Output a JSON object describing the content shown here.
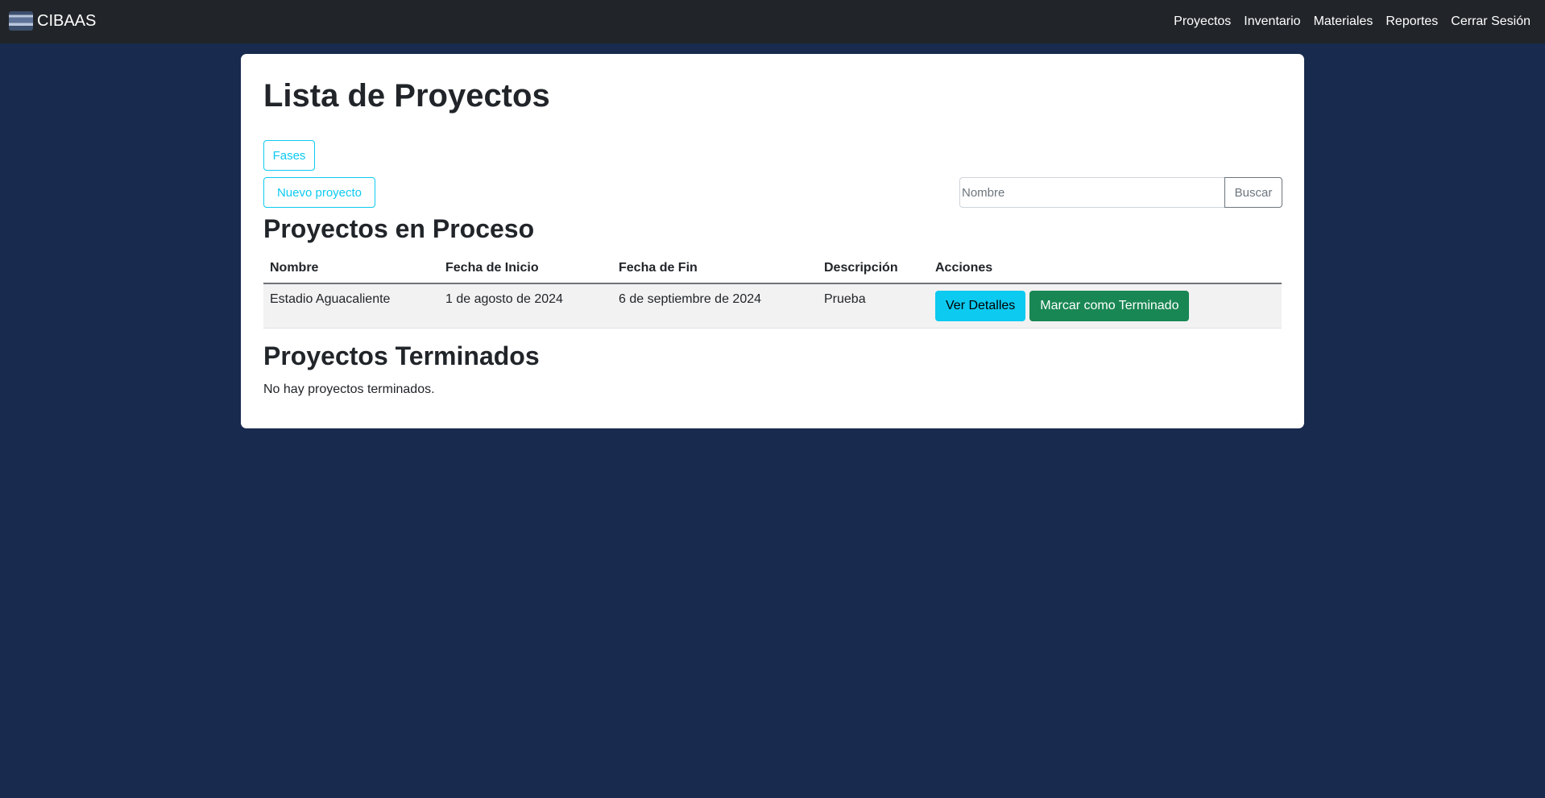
{
  "navbar": {
    "brand": "CIBAAS",
    "links": [
      "Proyectos",
      "Inventario",
      "Materiales",
      "Reportes",
      "Cerrar Sesión"
    ]
  },
  "page": {
    "title": "Lista de Proyectos",
    "fases_button": "Fases",
    "new_project_button": "Nuevo proyecto",
    "search": {
      "placeholder": "Nombre",
      "value": "",
      "button": "Buscar"
    }
  },
  "in_progress": {
    "title": "Proyectos en Proceso",
    "columns": [
      "Nombre",
      "Fecha de Inicio",
      "Fecha de Fin",
      "Descripción",
      "Acciones"
    ],
    "rows": [
      {
        "name": "Estadio Aguacaliente",
        "start": "1 de agosto de 2024",
        "end": "6 de septiembre de 2024",
        "description": "Prueba",
        "details_button": "Ver Detalles",
        "finish_button": "Marcar como Terminado"
      }
    ]
  },
  "finished": {
    "title": "Proyectos Terminados",
    "empty_message": "No hay proyectos terminados."
  },
  "colors": {
    "background": "#182a4d",
    "navbar": "#212529",
    "info": "#0dcaf0",
    "success": "#198754"
  }
}
